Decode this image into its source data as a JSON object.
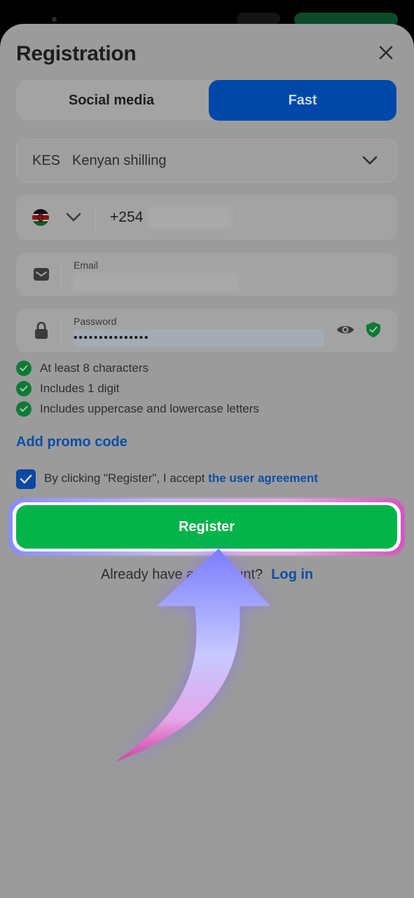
{
  "sheet": {
    "title": "Registration",
    "tabs": [
      {
        "label": "Social media",
        "active": false
      },
      {
        "label": "Fast",
        "active": true
      }
    ]
  },
  "currency": {
    "code": "KES",
    "name": "Kenyan shilling"
  },
  "phone": {
    "country_code": "+254",
    "flag": "kenya-flag-icon"
  },
  "email": {
    "label": "Email"
  },
  "password": {
    "label": "Password",
    "value_masked": "•••••••••••••••"
  },
  "password_rules": [
    "At least 8 characters",
    "Includes 1 digit",
    "Includes uppercase and lowercase letters"
  ],
  "promo": {
    "label": "Add promo code"
  },
  "agreement": {
    "checked": true,
    "text": "By clicking \"Register\", I accept ",
    "link": "the user agreement"
  },
  "register_button": {
    "label": "Register"
  },
  "login": {
    "text": "Already have an account?",
    "link": "Log in"
  },
  "colors": {
    "primary_blue": "#0048a8",
    "register_green": "#02b44a",
    "link_blue": "#0a4ea8",
    "check_green": "#0d7a35"
  }
}
